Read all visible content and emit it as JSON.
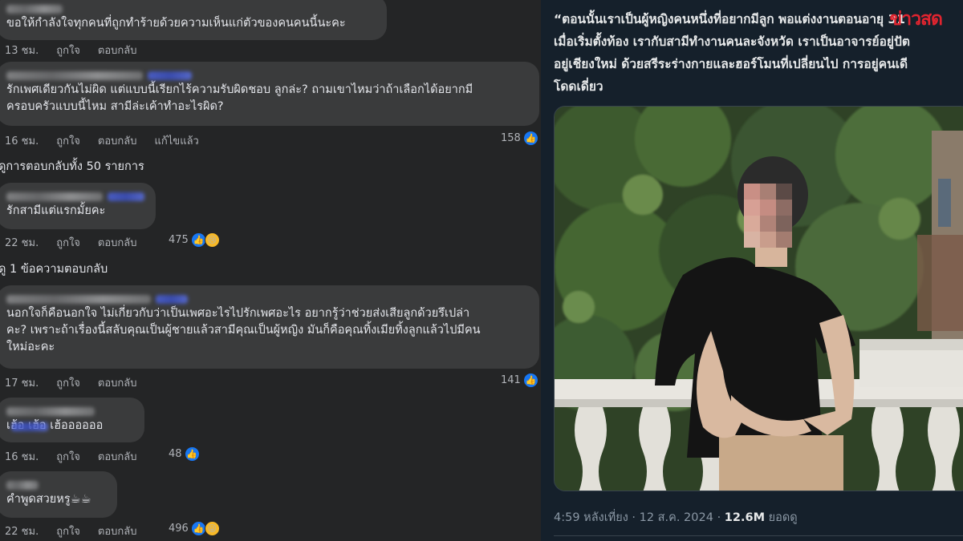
{
  "comments": [
    {
      "text_lines": [
        "ขอให้กำลังใจทุกคนที่ถูกทำร้ายด้วยความเห็นแก่ตัวของคนคนนี้นะคะ"
      ],
      "time": "13 ชม.",
      "like": "ถูกใจ",
      "reply": "ตอบกลับ"
    },
    {
      "text_lines": [
        "รักเพศเดียวกันไม่ผิด แต่แบบนี้เรียกไร้ความรับผิดชอบ ลูกล่ะ? ถามเขาไหมว่าถ้าเลือกได้อยากมี",
        "ครอบครัวแบบนี้ไหม สามีล่ะเค้าทำอะไรผิด?"
      ],
      "time": "16 ชม.",
      "like": "ถูกใจ",
      "reply": "ตอบกลับ",
      "edited": "แก้ไขแล้ว",
      "reactions": "158"
    },
    {
      "text_lines": [
        "รักสามีแต่แรกมั้ยคะ"
      ],
      "time": "22 ชม.",
      "like": "ถูกใจ",
      "reply": "ตอบกลับ",
      "reactions": "475"
    },
    {
      "text_lines": [
        "นอกใจก็คือนอกใจ ไม่เกี่ยวกับว่าเป็นเพศอะไรไปรักเพศอะไร อยากรู้ว่าช่วยส่งเสียลูกด้วยรึเปล่า",
        "คะ? เพราะถ้าเรื่องนี้สลับคุณเป็นผู้ชายแล้วสามีคุณเป็นผู้หญิง มันก็คือคุณทิ้งเมียทิ้งลูกแล้วไปมีคน",
        "ใหม่อะคะ"
      ],
      "time": "17 ชม.",
      "like": "ถูกใจ",
      "reply": "ตอบกลับ",
      "reactions": "141"
    },
    {
      "text_lines": [
        "เฮ้อ เฮ้อ เฮ้ออออออ"
      ],
      "time": "16 ชม.",
      "like": "ถูกใจ",
      "reply": "ตอบกลับ",
      "reactions": "48"
    },
    {
      "text_lines": [
        "คำพูดสวยหรู☕☕"
      ],
      "time": "22 ชม.",
      "like": "ถูกใจ",
      "reply": "ตอบกลับ",
      "reactions": "496"
    }
  ],
  "view_replies_50": "ดูการตอบกลับทั้ง 50 รายการ",
  "view_reply_1": "ดู 1 ข้อความตอบกลับ",
  "tweet": {
    "lines": [
      "“ตอนนั้นเราเป็นผู้หญิงคนหนึ่งที่อยากมีลูก พอแต่งงานตอนอายุ 31",
      "เมื่อเริ่มตั้งท้อง เรากับสามีทำงานคนละจังหวัด เราเป็นอาจารย์อยู่ปัต",
      "อยู่เชียงใหม่ ด้วยสรีระร่างกายและฮอร์โมนที่เปลี่ยนไป การอยู่คนเดี",
      "โดดเดี่ยว"
    ],
    "watermark": "ข่าวสด",
    "time": "4:59 หลังเที่ยง",
    "sep": "·",
    "date": "12 ส.ค. 2024",
    "views": "12.6M",
    "views_label": "ยอดดู"
  },
  "colors": {
    "fb_bg": "#242526",
    "bubble": "#3a3b3c",
    "tw_bg": "#15202b",
    "like_blue": "#1877f2",
    "watermark_red": "#e0242f"
  },
  "icons": [
    "like-icon",
    "sad-emoji-icon",
    "laugh-emoji-icon"
  ]
}
